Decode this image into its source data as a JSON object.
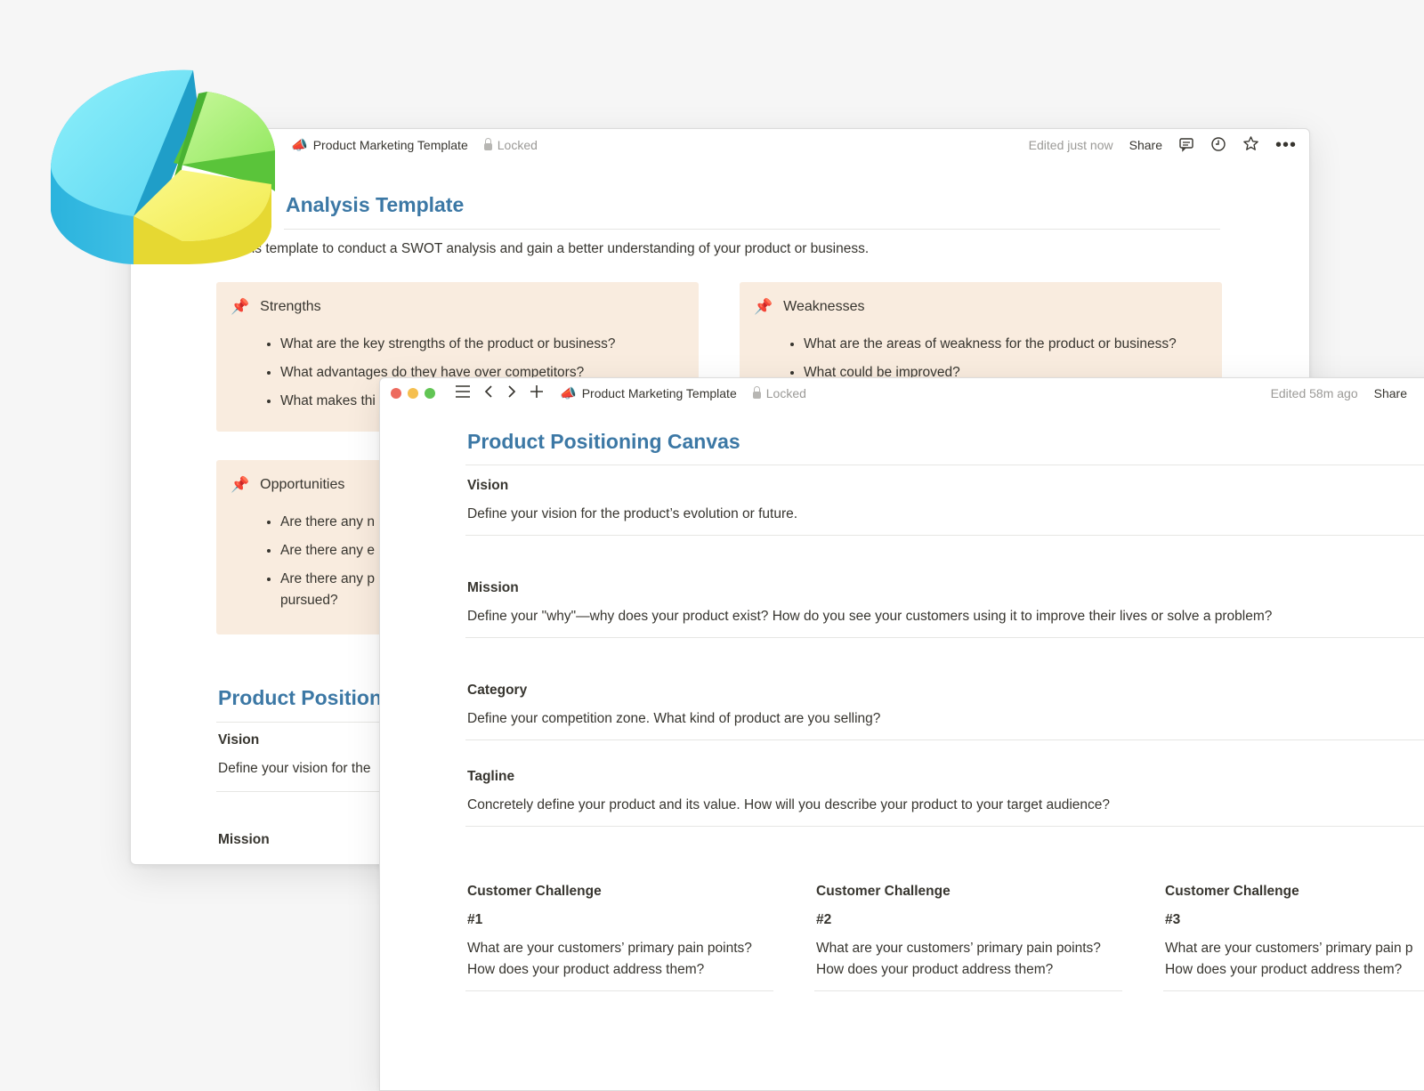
{
  "back_window": {
    "breadcrumb": "Product Marketing Template",
    "lock": "Locked",
    "edited": "Edited just now",
    "share": "Share",
    "title": "Analysis Template",
    "intro": "e this template to conduct a SWOT analysis and gain a better understanding of your product or business.",
    "strengths": {
      "title": "Strengths",
      "items": [
        "What are the key strengths of the product or business?",
        "What advantages do they have over competitors?",
        "What makes thi"
      ]
    },
    "weaknesses": {
      "title": "Weaknesses",
      "items": [
        "What are the areas of weakness for the product or business?",
        "What could be improved?"
      ]
    },
    "opportunities": {
      "title": "Opportunities",
      "items": [
        "Are there any n",
        "Are there any e",
        "Are there any p",
        "pursued?"
      ]
    },
    "section2_title": "Product Positioni",
    "vision_label": "Vision",
    "vision_text": "Define your vision for the",
    "mission_label": "Mission"
  },
  "front_window": {
    "breadcrumb": "Product Marketing Template",
    "lock": "Locked",
    "edited": "Edited 58m ago",
    "share": "Share",
    "title": "Product Positioning Canvas",
    "sections": [
      {
        "label": "Vision",
        "text": "Define your vision for the product’s evolution or future."
      },
      {
        "label": "Mission",
        "text": "Define your \"why\"—why does your product exist? How do you see your customers using it to improve their lives or solve a problem?"
      },
      {
        "label": "Category",
        "text": "Define your competition zone. What kind of product are you selling?"
      },
      {
        "label": "Tagline",
        "text": "Concretely define your product and its value. How will you describe your product to your target audience?"
      }
    ],
    "challenges": [
      {
        "label": "Customer Challenge",
        "num": "#1",
        "line1": "What are your customers’ primary pain points?",
        "line2": "How does your product address them?"
      },
      {
        "label": "Customer Challenge",
        "num": "#2",
        "line1": "What are your customers’ primary pain points?",
        "line2": "How does your product address them?"
      },
      {
        "label": "Customer Challenge",
        "num": "#3",
        "line1": "What are your customers’ primary pain p",
        "line2": "How does your product address them?"
      }
    ]
  },
  "icons": [
    "megaphone-icon",
    "lock-icon",
    "comment-icon",
    "clock-icon",
    "star-icon",
    "more-icon",
    "pin-icon",
    "menu-icon",
    "back-icon",
    "forward-icon",
    "add-icon"
  ],
  "colors": {
    "heading": "#3c78a5",
    "callout_bg": "#f9ecdf",
    "close": "#ed6a5e",
    "minimize": "#f5bf4f",
    "maximize": "#61c554"
  }
}
